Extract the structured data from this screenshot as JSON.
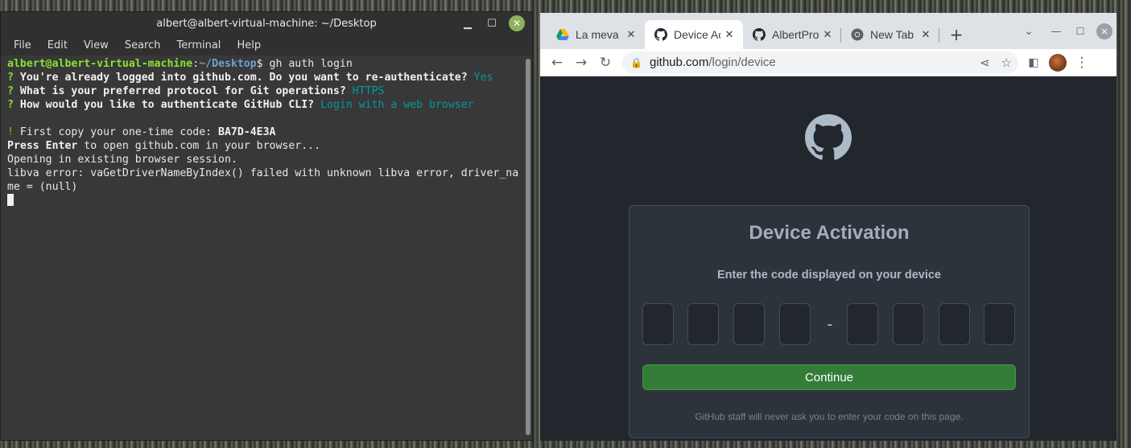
{
  "terminal": {
    "title": "albert@albert-virtual-machine: ~/Desktop",
    "menu": [
      "File",
      "Edit",
      "View",
      "Search",
      "Terminal",
      "Help"
    ],
    "lines": {
      "prompt_user": "albert@albert-virtual-machine",
      "prompt_colon": ":",
      "prompt_path": "~/Desktop",
      "prompt_cmd": "$ gh auth login",
      "q_mark": "?",
      "q1": " You're already logged into github.com. Do you want to re-authenticate?",
      "a1": " Yes",
      "q2": " What is your preferred protocol for Git operations?",
      "a2": " HTTPS",
      "q3": " How would you like to authenticate GitHub CLI?",
      "a3": " Login with a web browser",
      "bang": "!",
      "copy_prefix": " First copy your one-time code: ",
      "code": "BA7D-4E3A",
      "press_enter": "Press Enter",
      "press_rest": " to open github.com in your browser...",
      "opening": "Opening in existing browser session.",
      "libva1": "libva error: vaGetDriverNameByIndex() failed with unknown libva error, driver_na",
      "libva2": "me = (null)"
    }
  },
  "browser": {
    "tabs": [
      {
        "label": "La meva u",
        "icon": "google-drive-icon"
      },
      {
        "label": "Device Act",
        "icon": "github-icon"
      },
      {
        "label": "AlbertPro",
        "icon": "github-icon"
      },
      {
        "label": "New Tab",
        "icon": "chrome-icon"
      }
    ],
    "url_host": "github.com",
    "url_path": "/login/device",
    "page": {
      "title": "Device Activation",
      "subtitle": "Enter the code displayed on your device",
      "dash": "-",
      "continue_label": "Continue",
      "footnote": "GitHub staff will never ask you to enter your code on this page."
    }
  }
}
